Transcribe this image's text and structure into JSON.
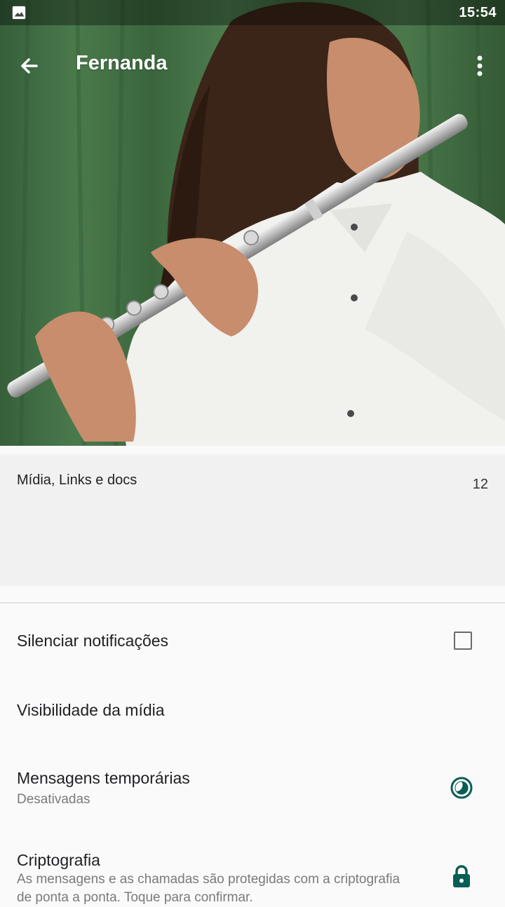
{
  "status_bar": {
    "time": "15:54",
    "notification_icon": "image-icon"
  },
  "toolbar": {
    "title": "Fernanda",
    "back_icon": "arrow-left-icon",
    "menu_icon": "more-vert-icon"
  },
  "media": {
    "label": "Mídia, Links e docs",
    "count": "12"
  },
  "settings": {
    "mute": {
      "label": "Silenciar notificações",
      "checked": false
    },
    "media_visibility": {
      "label": "Visibilidade da mídia"
    },
    "disappearing": {
      "label": "Mensagens temporárias",
      "status": "Desativadas"
    },
    "encryption": {
      "label": "Criptografia",
      "description": "As mensagens e as chamadas são protegidas com a criptografia de ponta a ponta. Toque para confirmar."
    }
  },
  "colors": {
    "accent": "#075e54",
    "background": "#fafafa"
  }
}
